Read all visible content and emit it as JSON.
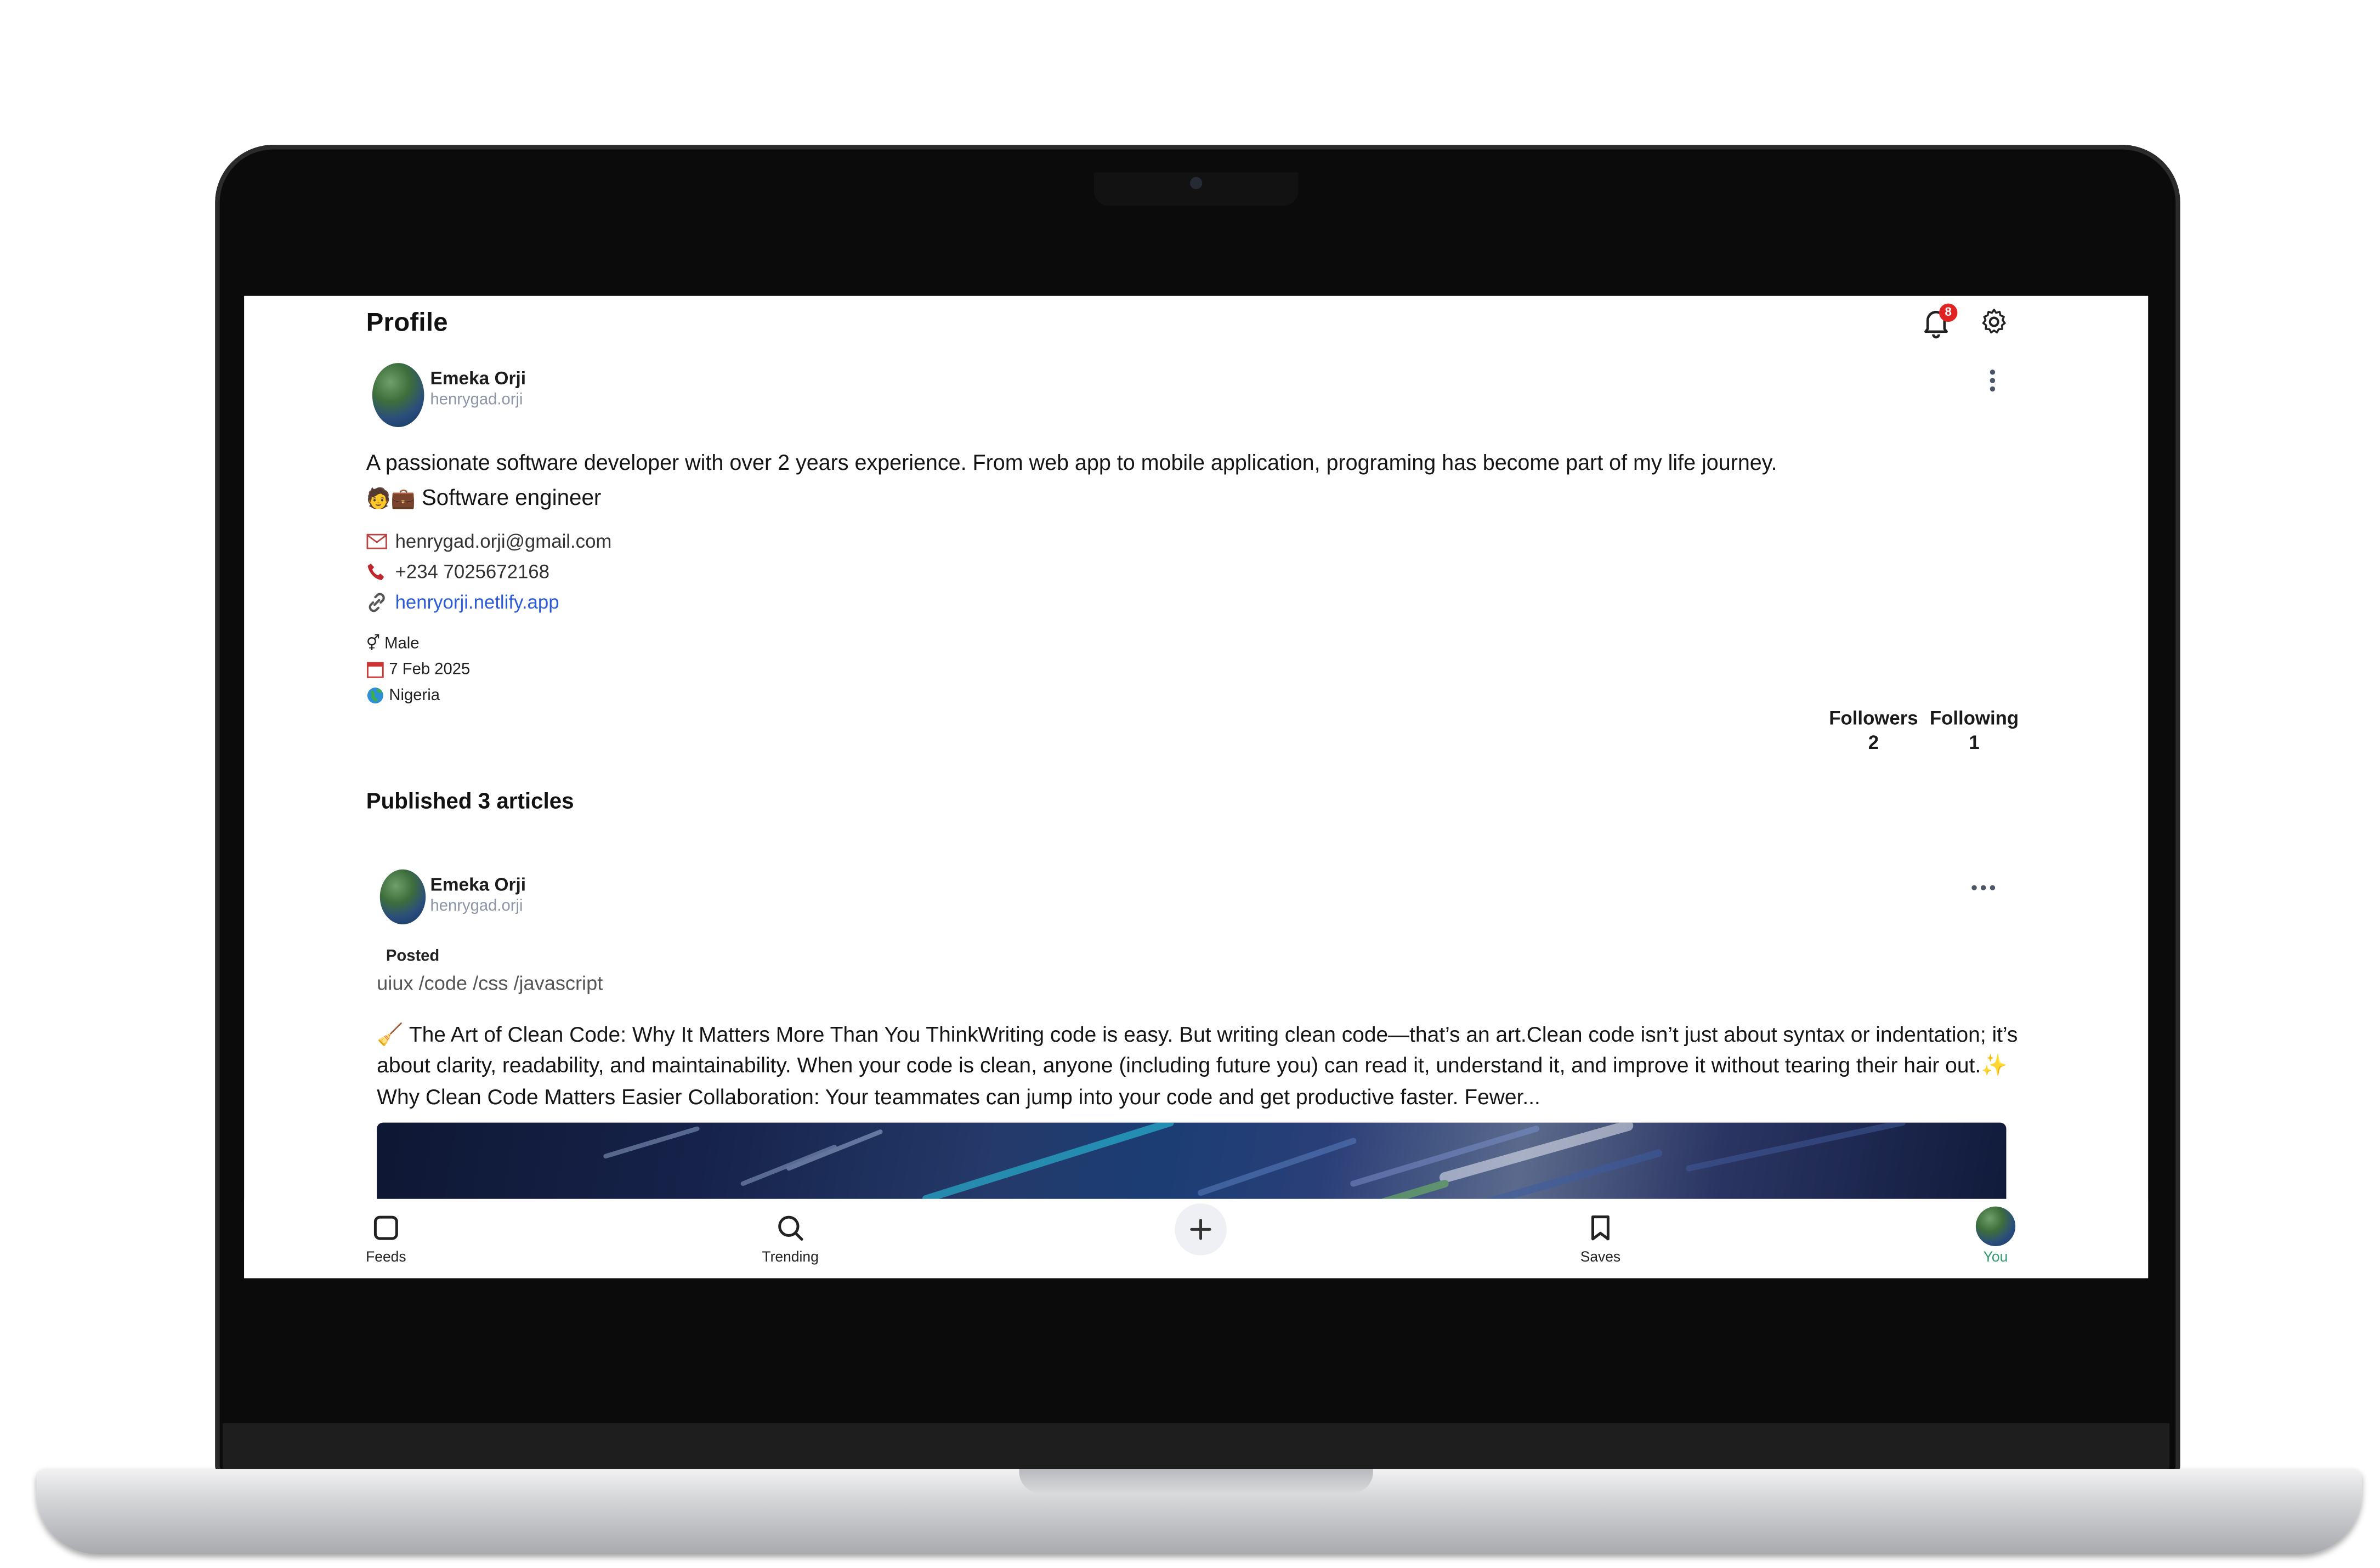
{
  "header": {
    "title": "Profile",
    "notification_count": "8",
    "bell_icon": "bell-icon",
    "settings_icon": "gear-icon"
  },
  "profile": {
    "name": "Emeka Orji",
    "username": "henrygad.orji",
    "bio": "A passionate software developer with over 2 years experience. From web app to mobile application, programing has become part of my life journey.",
    "role": "Software engineer",
    "role_emojis": "🧑💼",
    "email": "henrygad.orji@gmail.com",
    "phone": "+234 7025672168",
    "website": "henryorji.netlify.app",
    "gender": "Male",
    "date": "7 Feb 2025",
    "country": "Nigeria",
    "followers_label": "Followers",
    "followers_count": "2",
    "following_label": "Following",
    "following_count": "1"
  },
  "articles": {
    "heading": "Published 3 articles",
    "items": [
      {
        "author_name": "Emeka Orji",
        "author_handle": "henrygad.orji",
        "status": "Posted",
        "tags": "uiux /code /css /javascript",
        "excerpt": "The Art of Clean Code: Why It Matters More Than You ThinkWriting code is easy. But writing clean code—that’s an art.Clean code isn’t just about syntax or indentation; it’s about clarity, readability, and maintainability. When your code is clean, anyone (including future you) can read it, understand it, and improve it without tearing their hair out.",
        "excerpt_2": "Why Clean Code Matters Easier Collaboration: Your teammates can jump into your code and get productive faster. Fewer..."
      }
    ]
  },
  "bottom_nav": {
    "items": [
      {
        "label": "Feeds",
        "icon": "square-icon"
      },
      {
        "label": "Trending",
        "icon": "search-icon"
      },
      {
        "label": "",
        "icon": "plus-icon"
      },
      {
        "label": "Saves",
        "icon": "bookmark-icon"
      },
      {
        "label": "You",
        "icon": "avatar"
      }
    ],
    "active_color": "#2f9e6e"
  }
}
